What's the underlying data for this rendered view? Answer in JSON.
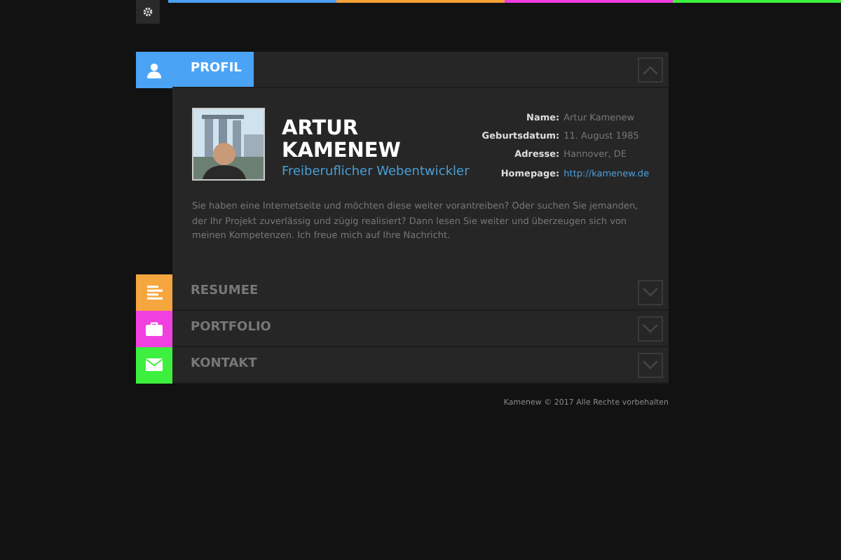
{
  "top_bar": {
    "stripes": [
      {
        "color": "#4a9ff0"
      },
      {
        "color": "#f6a136"
      },
      {
        "color": "#f03ee0"
      },
      {
        "color": "#3ef03e"
      }
    ]
  },
  "sections": [
    {
      "kind": "profile",
      "label": "PROFIL",
      "color": "#4aa3f5",
      "expanded": true,
      "profile": {
        "name": "ARTUR KAMENEW",
        "subtitle": "Freiberuflicher Webentwickler",
        "details": [
          {
            "label": "Name:",
            "value": "Artur Kamenew",
            "kind": "text"
          },
          {
            "label": "Geburtsdatum:",
            "value": "11. August 1985",
            "kind": "text"
          },
          {
            "label": "Adresse:",
            "value": "Hannover, DE",
            "kind": "text"
          },
          {
            "label": "Homepage:",
            "value": "http://kamenew.de",
            "kind": "link"
          }
        ],
        "intro": "Sie haben eine Internetseite und möchten diese weiter vorantreiben? Oder suchen Sie jemanden, der Ihr Projekt zuverlässig und zügig realisiert? Dann lesen Sie weiter und überzeugen sich von meinen Kompetenzen. Ich freue mich auf Ihre Nachricht."
      }
    },
    {
      "kind": "resume",
      "label": "RESUMEE",
      "color": "#f6a63e",
      "expanded": false
    },
    {
      "kind": "portfolio",
      "label": "PORTFOLIO",
      "color": "#f040e0",
      "expanded": false
    },
    {
      "kind": "contact",
      "label": "KONTAKT",
      "color": "#3ef03e",
      "expanded": false
    }
  ],
  "footer": "Kamenew © 2017 Alle Rechte vorbehalten"
}
